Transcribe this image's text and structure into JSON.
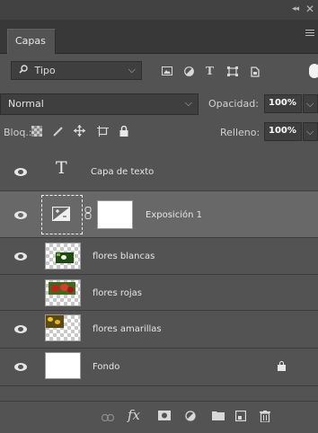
{
  "panel": {
    "collapse_glyph": "◂◂",
    "close_glyph": "✕",
    "tab_label": "Capas"
  },
  "filter": {
    "kind_label": "Tipo",
    "icons": [
      "image-filter-icon",
      "adjustment-filter-icon",
      "type-filter-icon",
      "shape-filter-icon",
      "smart-object-filter-icon"
    ]
  },
  "blend": {
    "mode": "Normal",
    "opacity_label": "Opacidad:",
    "opacity_value": "100%"
  },
  "lock": {
    "label": "Bloq.:",
    "fill_label": "Relleno:",
    "fill_value": "100%"
  },
  "layers": [
    {
      "name": "Capa de texto",
      "visible": true,
      "kind": "text"
    },
    {
      "name": "Exposición 1",
      "visible": true,
      "kind": "adjustment",
      "selected": true
    },
    {
      "name": "flores blancas",
      "visible": true,
      "kind": "pixel"
    },
    {
      "name": "flores rojas",
      "visible": false,
      "kind": "pixel"
    },
    {
      "name": "flores amarillas",
      "visible": true,
      "kind": "pixel"
    },
    {
      "name": "Fondo",
      "visible": true,
      "kind": "background",
      "locked": true
    }
  ],
  "colors": {
    "panel_bg": "#535353",
    "selected_row": "#686868",
    "tab_bar": "#383838"
  }
}
